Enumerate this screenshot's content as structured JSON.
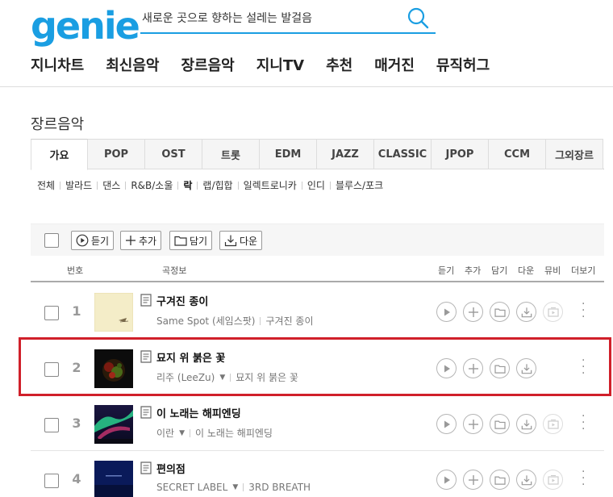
{
  "header": {
    "logo": "genie",
    "search_placeholder": "새로운 곳으로 향하는 설레는 발걸음"
  },
  "nav": [
    "지니차트",
    "최신음악",
    "장르음악",
    "지니TV",
    "추천",
    "매거진",
    "뮤직허그"
  ],
  "page_title": "장르음악",
  "genre_tabs": [
    "가요",
    "POP",
    "OST",
    "트롯",
    "EDM",
    "JAZZ",
    "CLASSIC",
    "JPOP",
    "CCM",
    "그외장르"
  ],
  "active_tab": "가요",
  "subgenres": [
    "전체",
    "발라드",
    "댄스",
    "R&B/소울",
    "락",
    "랩/힙합",
    "일렉트로니카",
    "인디",
    "블루스/포크"
  ],
  "toolbar": {
    "listen": "듣기",
    "add": "추가",
    "save": "담기",
    "download": "다운"
  },
  "list_header": {
    "number": "번호",
    "info": "곡정보",
    "listen": "듣기",
    "add": "추가",
    "save": "담기",
    "download": "다운",
    "mv": "뮤비",
    "more": "더보기"
  },
  "songs": [
    {
      "rank": "1",
      "title": "구겨진 종이",
      "artist": "Same Spot (세임스팟)",
      "album": "구겨진 종이",
      "has_artist_menu": false
    },
    {
      "rank": "2",
      "title": "묘지 위 붉은 꽃",
      "artist": "리주 (LeeZu)",
      "album": "묘지 위 붉은 꽃",
      "has_artist_menu": true
    },
    {
      "rank": "3",
      "title": "이 노래는 해피엔딩",
      "artist": "이란",
      "album": "이 노래는 해피엔딩",
      "has_artist_menu": true
    },
    {
      "rank": "4",
      "title": "편의점",
      "artist": "SECRET LABEL",
      "album": "3RD BREATH",
      "has_artist_menu": true
    }
  ],
  "colors": {
    "brand": "#1a9ee2",
    "highlight": "#d0202a"
  }
}
